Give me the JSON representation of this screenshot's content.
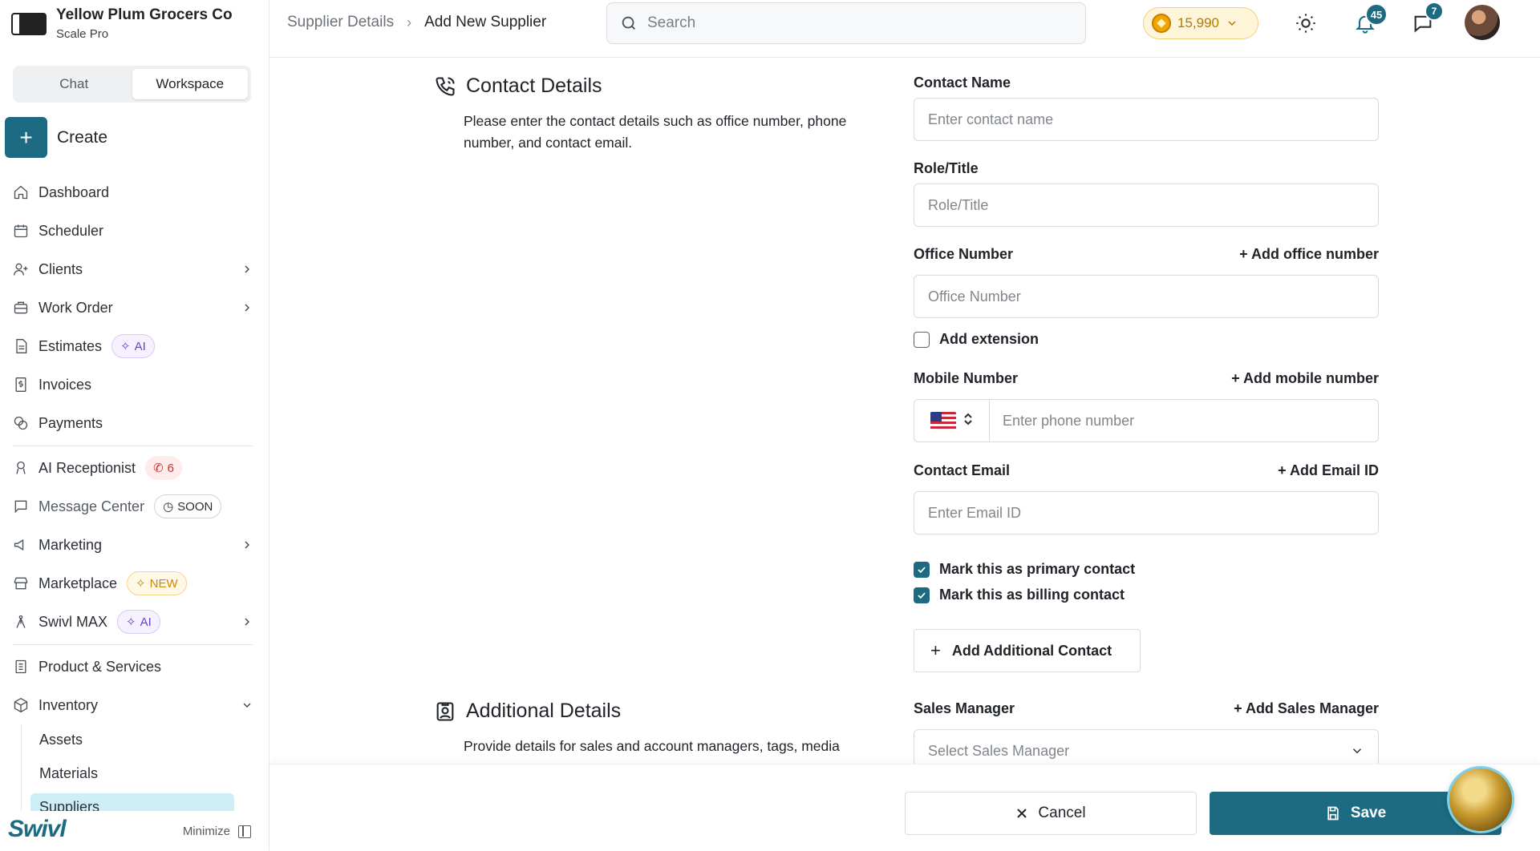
{
  "org": {
    "name": "Yellow Plum Grocers Co",
    "plan": "Scale Pro"
  },
  "sidebar": {
    "tabs": [
      {
        "label": "Chat",
        "active": false
      },
      {
        "label": "Workspace",
        "active": true
      }
    ],
    "create_label": "Create",
    "items": [
      {
        "label": "Dashboard",
        "icon": "home-icon"
      },
      {
        "label": "Scheduler",
        "icon": "calendar-icon"
      },
      {
        "label": "Clients",
        "icon": "user-plus-icon",
        "chevron": true
      },
      {
        "label": "Work Order",
        "icon": "briefcase-icon",
        "chevron": true
      },
      {
        "label": "Estimates",
        "icon": "document-icon",
        "badge": "AI"
      },
      {
        "label": "Invoices",
        "icon": "dollar-document-icon"
      },
      {
        "label": "Payments",
        "icon": "coins-icon"
      },
      {
        "label": "AI Receptionist",
        "icon": "receptionist-icon",
        "badge": "6"
      },
      {
        "label": "Message Center",
        "icon": "message-icon",
        "badge": "SOON"
      },
      {
        "label": "Marketing",
        "icon": "megaphone-icon",
        "chevron": true
      },
      {
        "label": "Marketplace",
        "icon": "store-icon",
        "badge": "NEW"
      },
      {
        "label": "Swivl MAX",
        "icon": "swivl-max-icon",
        "badge": "AI",
        "chevron": true
      },
      {
        "label": "Product & Services",
        "icon": "clipboard-icon"
      },
      {
        "label": "Inventory",
        "icon": "box-icon",
        "expanded": true
      }
    ],
    "inventory_sub": [
      "Assets",
      "Materials",
      "Suppliers"
    ],
    "active_sub": "Suppliers",
    "brand": "Swivl",
    "minimize_label": "Minimize"
  },
  "header": {
    "breadcrumb": [
      "Supplier Details",
      "Add New Supplier"
    ],
    "search_placeholder": "Search",
    "coins": "15,990",
    "notifications_count": "45",
    "messages_count": "7"
  },
  "contact_section": {
    "title": "Contact Details",
    "description": "Please enter the contact details such as office number, phone number, and contact email.",
    "fields": {
      "contact_name": {
        "label": "Contact Name",
        "placeholder": "Enter contact name",
        "value": ""
      },
      "role_title": {
        "label": "Role/Title",
        "placeholder": "Role/Title",
        "value": ""
      },
      "office_number": {
        "label": "Office Number",
        "link": "+ Add office number",
        "placeholder": "Office Number",
        "value": ""
      },
      "add_extension": {
        "label": "Add extension",
        "checked": false
      },
      "mobile_number": {
        "label": "Mobile Number",
        "link": "+ Add mobile number",
        "placeholder": "Enter phone number",
        "country": "US",
        "value": ""
      },
      "contact_email": {
        "label": "Contact Email",
        "link": "+ Add Email ID",
        "placeholder": "Enter Email ID",
        "value": ""
      },
      "primary_contact": {
        "label": "Mark this as primary contact",
        "checked": true
      },
      "billing_contact": {
        "label": "Mark this as billing contact",
        "checked": true
      }
    },
    "add_contact_label": "Add Additional Contact"
  },
  "additional_section": {
    "title": "Additional Details",
    "description": "Provide details for sales and account managers, tags, media",
    "sales_manager": {
      "label": "Sales Manager",
      "link": "+ Add Sales Manager",
      "placeholder": "Select Sales Manager"
    }
  },
  "footer": {
    "cancel_label": "Cancel",
    "save_label": "Save"
  },
  "colors": {
    "accent": "#1c6b83",
    "active_sub_bg": "#cdeef6"
  }
}
